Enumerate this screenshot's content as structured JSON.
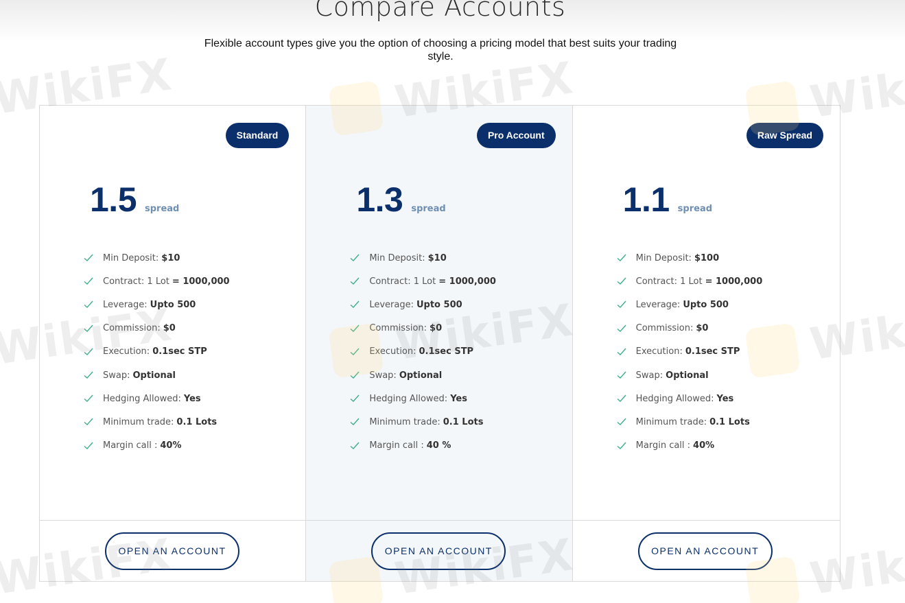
{
  "page": {
    "title": "Compare Accounts",
    "subtitle_line1": "Flexible account types give you the option of choosing a pricing model that best suits your trading",
    "subtitle_line2": "style."
  },
  "watermark": {
    "text": "WikiFX"
  },
  "colors": {
    "brand": "#0b2f6b",
    "spread_label": "#6f8fb3",
    "check": "#3fae8c",
    "featured_bg": "#f4f7fa"
  },
  "cards": [
    {
      "badge": "Standard",
      "spread_value": "1.5",
      "spread_label": "spread",
      "features": [
        {
          "label": "Min Deposit:",
          "value": "$10"
        },
        {
          "label": "Contract: 1 Lot",
          "value": "= 1000,000"
        },
        {
          "label": "Leverage:",
          "value": "Upto 500"
        },
        {
          "label": "Commission:",
          "value": "$0"
        },
        {
          "label": "Execution:",
          "value": "0.1sec STP"
        },
        {
          "label": "Swap:",
          "value": "Optional"
        },
        {
          "label": "Hedging Allowed:",
          "value": "Yes"
        },
        {
          "label": "Minimum trade:",
          "value": "0.1 Lots"
        },
        {
          "label": "Margin call :",
          "value": "40%"
        }
      ],
      "button": "OPEN AN ACCOUNT"
    },
    {
      "badge": "Pro Account",
      "spread_value": "1.3",
      "spread_label": "spread",
      "features": [
        {
          "label": "Min Deposit:",
          "value": "$10"
        },
        {
          "label": "Contract: 1 Lot",
          "value": "= 1000,000"
        },
        {
          "label": "Leverage:",
          "value": "Upto 500"
        },
        {
          "label": "Commission:",
          "value": "$0"
        },
        {
          "label": "Execution:",
          "value": "0.1sec STP"
        },
        {
          "label": "Swap:",
          "value": "Optional"
        },
        {
          "label": "Hedging Allowed:",
          "value": "Yes"
        },
        {
          "label": "Minimum trade:",
          "value": "0.1 Lots"
        },
        {
          "label": "Margin call :",
          "value": "40 %"
        }
      ],
      "button": "OPEN AN ACCOUNT"
    },
    {
      "badge": "Raw Spread",
      "spread_value": "1.1",
      "spread_label": "spread",
      "features": [
        {
          "label": "Min Deposit:",
          "value": "$100"
        },
        {
          "label": "Contract: 1 Lot",
          "value": "= 1000,000"
        },
        {
          "label": "Leverage:",
          "value": "Upto 500"
        },
        {
          "label": "Commission:",
          "value": "$0"
        },
        {
          "label": "Execution:",
          "value": "0.1sec STP"
        },
        {
          "label": "Swap:",
          "value": "Optional"
        },
        {
          "label": "Hedging Allowed:",
          "value": "Yes"
        },
        {
          "label": "Minimum trade:",
          "value": "0.1 Lots"
        },
        {
          "label": "Margin call :",
          "value": "40%"
        }
      ],
      "button": "OPEN AN ACCOUNT"
    }
  ]
}
